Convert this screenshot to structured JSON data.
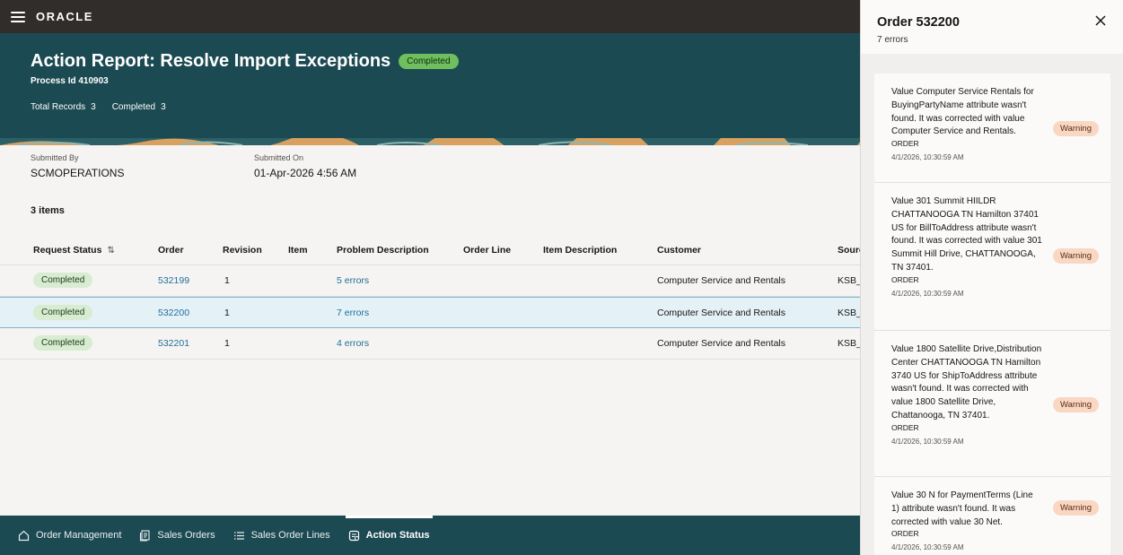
{
  "topbar": {
    "logo": "ORACLE"
  },
  "header": {
    "title": "Action Report: Resolve Import Exceptions",
    "status": "Completed",
    "process_id": "Process Id 410903",
    "total_records_label": "Total Records",
    "total_records": "3",
    "completed_label": "Completed",
    "completed": "3"
  },
  "meta": {
    "submitted_by_label": "Submitted By",
    "submitted_by": "SCMOPERATIONS",
    "submitted_on_label": "Submitted On",
    "submitted_on": "01-Apr-2026 4:56 AM"
  },
  "items_count": "3 items",
  "table": {
    "headers": [
      "Request Status",
      "Order",
      "Revision",
      "Item",
      "Problem Description",
      "Order Line",
      "Item Description",
      "Customer",
      "Sourc"
    ],
    "rows": [
      {
        "status": "Completed",
        "order": "532199",
        "revision": "1",
        "problem": "5 errors",
        "customer": "Computer Service and Rentals",
        "source": "KSB_"
      },
      {
        "status": "Completed",
        "order": "532200",
        "revision": "1",
        "problem": "7 errors",
        "customer": "Computer Service and Rentals",
        "source": "KSB_"
      },
      {
        "status": "Completed",
        "order": "532201",
        "revision": "1",
        "problem": "4 errors",
        "customer": "Computer Service and Rentals",
        "source": "KSB_"
      }
    ]
  },
  "bottomnav": {
    "items": [
      {
        "label": "Order Management",
        "icon": "home-icon"
      },
      {
        "label": "Sales Orders",
        "icon": "documents-icon"
      },
      {
        "label": "Sales Order Lines",
        "icon": "list-icon"
      },
      {
        "label": "Action Status",
        "icon": "report-icon"
      }
    ]
  },
  "drawer": {
    "title": "Order 532200",
    "subtitle": "7 errors",
    "errors": [
      {
        "message": "Value Computer Service Rentals for BuyingPartyName attribute wasn't found. It was corrected with value Computer Service and Rentals.",
        "type": "ORDER",
        "time": "4/1/2026, 10:30:59 AM",
        "badge": "Warning"
      },
      {
        "message": "Value 301 Summit HIILDR CHATTANOOGA TN Hamilton 37401 US for BillToAddress attribute wasn't found. It was corrected with value 301 Summit Hill Drive, CHATTANOOGA, TN 37401.",
        "type": "ORDER",
        "time": "4/1/2026, 10:30:59 AM",
        "badge": "Warning"
      },
      {
        "message": "Value 1800 Satellite Drive,Distribution Center CHATTANOOGA TN Hamilton 3740 US for ShipToAddress attribute wasn't found. It was corrected with value 1800 Satellite Drive, Chattanooga, TN 37401.",
        "type": "ORDER",
        "time": "4/1/2026, 10:30:59 AM",
        "badge": "Warning"
      },
      {
        "message": "Value 30 N for PaymentTerms (Line 1) attribute wasn't found. It was corrected with value 30 Net.",
        "type": "ORDER",
        "time": "4/1/2026, 10:30:59 AM",
        "badge": "Warning"
      }
    ]
  },
  "colors": {
    "header_bg": "#1c4a52",
    "topbar_bg": "#312d2a",
    "link": "#1f6f9b",
    "success_pill": "#d7ecd1",
    "warning_pill": "#f9d7c3"
  }
}
